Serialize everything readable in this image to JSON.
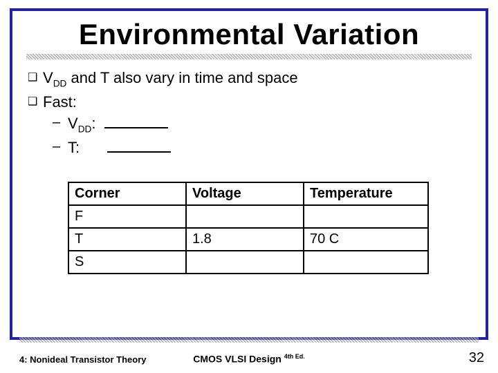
{
  "title": "Environmental Variation",
  "bullets": {
    "b1_pre": "V",
    "b1_sub": "DD",
    "b1_post": " and T also vary in time and space",
    "b2": "Fast:",
    "s1_pre": "V",
    "s1_sub": "DD",
    "s1_post": ":",
    "s2": "T:"
  },
  "table": {
    "headers": {
      "corner": "Corner",
      "voltage": "Voltage",
      "temperature": "Temperature"
    },
    "rows": [
      {
        "corner": "F",
        "voltage": "",
        "temperature": ""
      },
      {
        "corner": "T",
        "voltage": "1.8",
        "temperature": "70 C"
      },
      {
        "corner": "S",
        "voltage": "",
        "temperature": ""
      }
    ]
  },
  "footer": {
    "left": "4: Nonideal Transistor Theory",
    "center_main": "CMOS VLSI Design ",
    "center_ed": "4th Ed.",
    "page": "32"
  }
}
